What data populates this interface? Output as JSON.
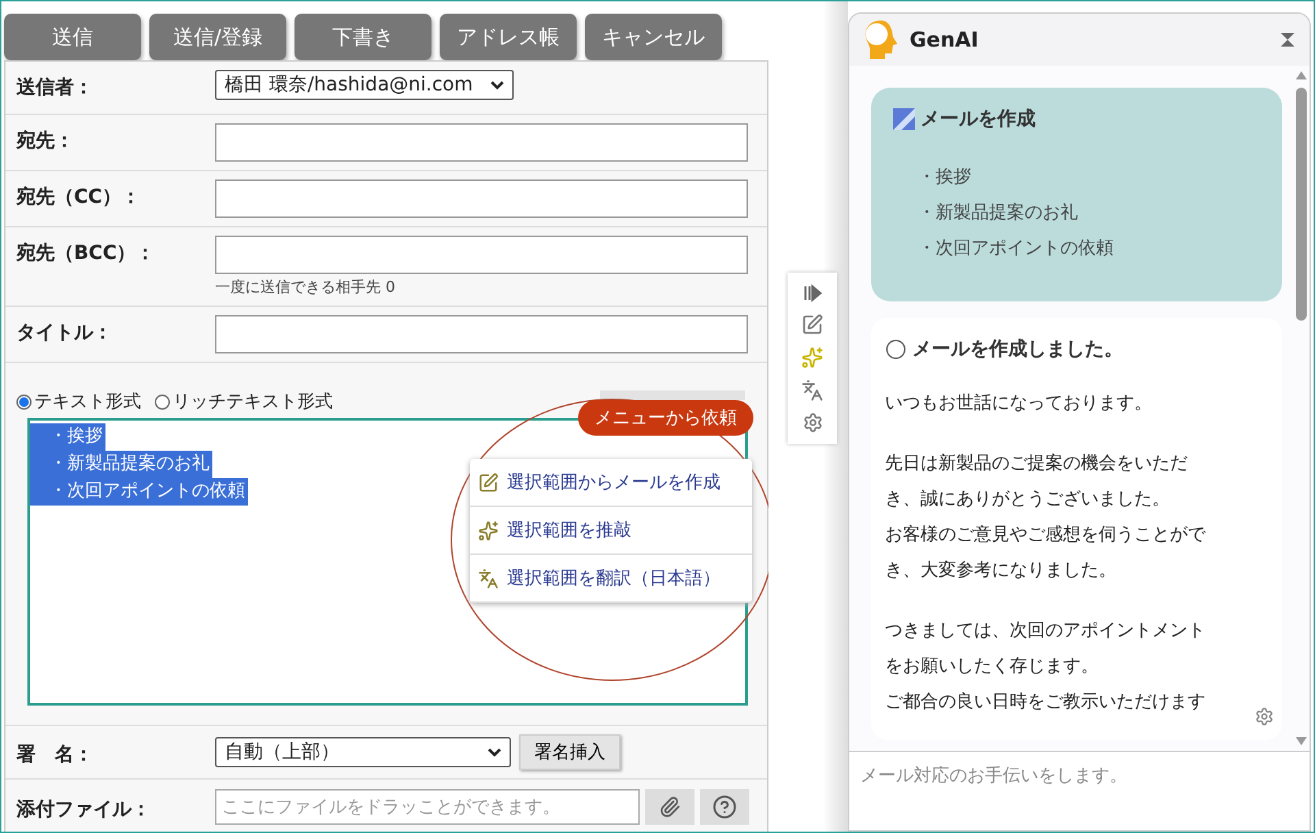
{
  "toolbar": {
    "buttons": [
      "送信",
      "送信/登録",
      "下書き",
      "アドレス帳",
      "キャンセル"
    ]
  },
  "form": {
    "rows": [
      {
        "kind": "select",
        "label": "送信者：",
        "value": "橋田 環奈/hashida@ni.com"
      },
      {
        "kind": "textarea",
        "label": "宛先："
      },
      {
        "kind": "textarea",
        "label": "宛先（CC）："
      },
      {
        "kind": "textarea",
        "label": "宛先（BCC）：",
        "note": "一度に送信できる相手先 0"
      },
      {
        "kind": "input",
        "label": "タイトル："
      }
    ]
  },
  "format_options": [
    {
      "label": "テキスト形式",
      "selected": true
    },
    {
      "label": "リッチテキスト形式",
      "selected": false
    }
  ],
  "body": {
    "lines": [
      {
        "text": "・挨拶",
        "selected": true
      },
      {
        "text": "・新製品提案のお礼",
        "selected": true
      },
      {
        "text": "・次回アポイントの依頼",
        "selected": true
      }
    ]
  },
  "context_menu": {
    "items": [
      "選択範囲からメールを作成",
      "選択範囲を推敲",
      "選択範囲を翻訳（日本語）"
    ]
  },
  "callout": "メニューから依頼",
  "signature": {
    "label": "署　名：",
    "value": "自動（上部）",
    "button": "署名挿入"
  },
  "attachment": {
    "label": "添付ファイル：",
    "placeholder": "ここにファイルをドラッことができます。"
  },
  "assistant": {
    "title": "GenAI",
    "request": {
      "title": "メールを作成",
      "items": [
        "・挨拶",
        "・新製品提案のお礼",
        "・次回アポイントの依頼"
      ]
    },
    "response": {
      "title": "メールを作成しました。",
      "paragraphs": [
        [
          "いつもお世話になっております。"
        ],
        [
          "先日は新製品のご提案の機会をいただ",
          "き、誠にありがとうございました。",
          "お客様のご意見やご感想を伺うことがで",
          "き、大変参考になりました。"
        ],
        [
          "つきましては、次回のアポイントメント",
          "をお願いしたく存じます。",
          "ご都合の良い日時をご教示いただけます"
        ]
      ]
    },
    "input": {
      "placeholder": "メール対応のお手伝いをします。"
    }
  }
}
